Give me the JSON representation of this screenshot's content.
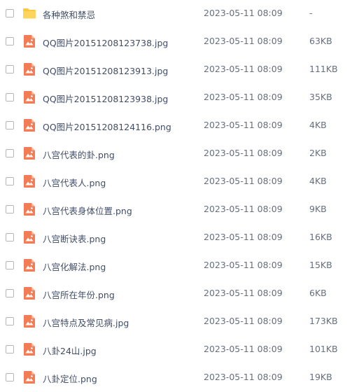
{
  "colors": {
    "folder": "#fcc83c",
    "image_icon": "#f47c54",
    "text": "#424e67",
    "muted": "#666e80"
  },
  "files": [
    {
      "icon": "folder-icon",
      "name": "各种煞和禁忌",
      "date": "2023-05-11 08:09",
      "size": "-"
    },
    {
      "icon": "image-file-icon",
      "name": "QQ图片20151208123738.jpg",
      "date": "2023-05-11 08:09",
      "size": "63KB"
    },
    {
      "icon": "image-file-icon",
      "name": "QQ图片20151208123913.jpg",
      "date": "2023-05-11 08:09",
      "size": "111KB"
    },
    {
      "icon": "image-file-icon",
      "name": "QQ图片20151208123938.jpg",
      "date": "2023-05-11 08:09",
      "size": "35KB"
    },
    {
      "icon": "image-file-icon",
      "name": "QQ图片20151208124116.png",
      "date": "2023-05-11 08:09",
      "size": "4KB"
    },
    {
      "icon": "image-file-icon",
      "name": "八宫代表的卦.png",
      "date": "2023-05-11 08:09",
      "size": "2KB"
    },
    {
      "icon": "image-file-icon",
      "name": "八宫代表人.png",
      "date": "2023-05-11 08:09",
      "size": "4KB"
    },
    {
      "icon": "image-file-icon",
      "name": "八宫代表身体位置.png",
      "date": "2023-05-11 08:09",
      "size": "9KB"
    },
    {
      "icon": "image-file-icon",
      "name": "八宫断诀表.png",
      "date": "2023-05-11 08:09",
      "size": "16KB"
    },
    {
      "icon": "image-file-icon",
      "name": "八宫化解法.png",
      "date": "2023-05-11 08:09",
      "size": "15KB"
    },
    {
      "icon": "image-file-icon",
      "name": "八宫所在年份.png",
      "date": "2023-05-11 08:09",
      "size": "6KB"
    },
    {
      "icon": "image-file-icon",
      "name": "八宫特点及常见病.jpg",
      "date": "2023-05-11 08:09",
      "size": "173KB"
    },
    {
      "icon": "image-file-icon",
      "name": "八卦24山.jpg",
      "date": "2023-05-11 08:09",
      "size": "101KB"
    },
    {
      "icon": "image-file-icon",
      "name": "八卦定位.png",
      "date": "2023-05-11 08:09",
      "size": "19KB"
    }
  ]
}
